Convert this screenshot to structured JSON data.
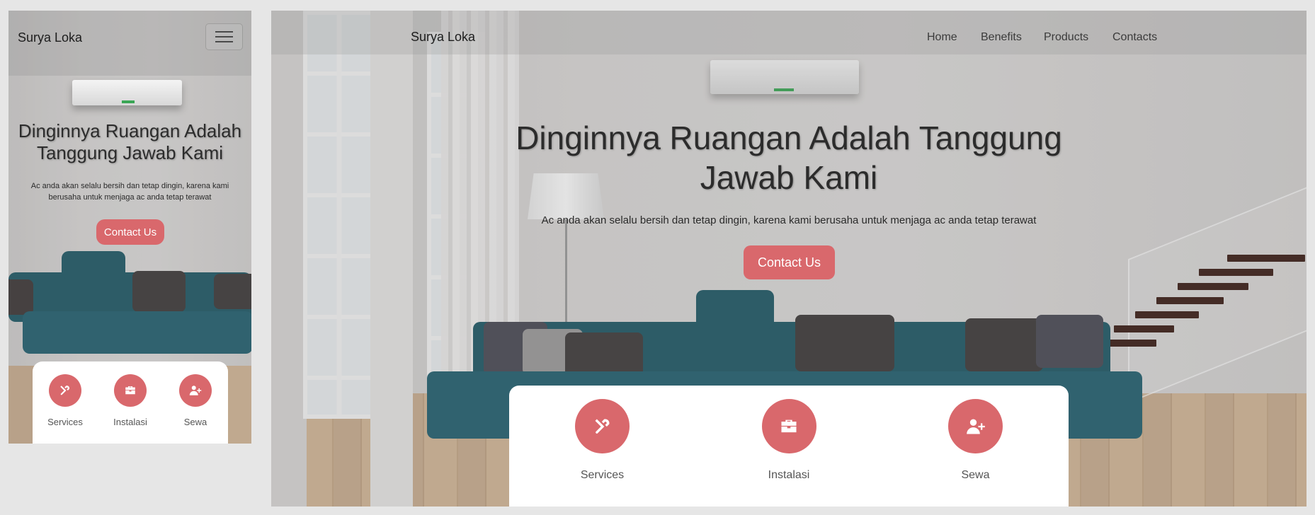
{
  "brand": "Surya Loka",
  "nav": {
    "links": [
      "Home",
      "Benefits",
      "Products",
      "Contacts"
    ],
    "toggler_icon": "hamburger-menu-icon"
  },
  "hero": {
    "title": "Dinginnya Ruangan Adalah Tanggung Jawab Kami",
    "subtitle": "Ac anda akan selalu bersih dan tetap dingin, karena kami berusaha untuk menjaga ac anda tetap terawat",
    "cta": "Contact Us"
  },
  "features": [
    {
      "label": "Services",
      "icon": "tools-icon"
    },
    {
      "label": "Instalasi",
      "icon": "toolbox-icon"
    },
    {
      "label": "Sewa",
      "icon": "user-plus-icon"
    }
  ],
  "colors": {
    "accent": "#d9686c",
    "card": "#ffffff",
    "text_dark": "#2c2c2c",
    "page_bg": "#e6e6e6"
  }
}
